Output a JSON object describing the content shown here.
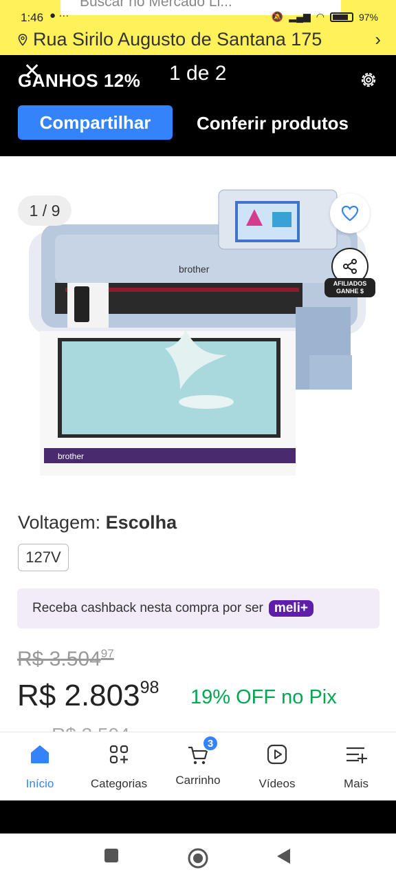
{
  "status": {
    "time": "1:46",
    "dots": "●  ···",
    "battery": "97%",
    "search_ghost": "Buscar no Mercado Li..."
  },
  "address": {
    "text": "Rua Sirilo Augusto de Santana 175",
    "chevron": "›"
  },
  "affiliate": {
    "gains": "GANHOS 12%",
    "pager": "1 de 2",
    "share_label": "Compartilhar",
    "products_label": "Conferir produtos"
  },
  "gallery": {
    "counter": "1 / 9",
    "affiliate_badge_line1": "AFILIADOS",
    "affiliate_badge_line2": "GANHE $",
    "brand_top": "brother",
    "brand_mat": "brother"
  },
  "voltage": {
    "label": "Voltagem: ",
    "value": "Escolha",
    "option": "127V"
  },
  "cashback": {
    "text": "Receba cashback nesta compra por ser",
    "badge": "meli+"
  },
  "price": {
    "old": "R$ 3.504",
    "old_cents": "97",
    "current": "R$ 2.803",
    "current_cents": "98",
    "discount": "19% OFF no Pix",
    "ghost": "R$ 3.504"
  },
  "nav": [
    {
      "label": "Início",
      "icon": "home-icon"
    },
    {
      "label": "Categorias",
      "icon": "categories-icon"
    },
    {
      "label": "Carrinho",
      "icon": "cart-icon",
      "badge": "3"
    },
    {
      "label": "Vídeos",
      "icon": "video-icon"
    },
    {
      "label": "Mais",
      "icon": "more-icon"
    }
  ],
  "colors": {
    "yellow": "#fff159",
    "blue": "#3483fa",
    "green": "#00a650",
    "purple": "#5f1eaa"
  }
}
